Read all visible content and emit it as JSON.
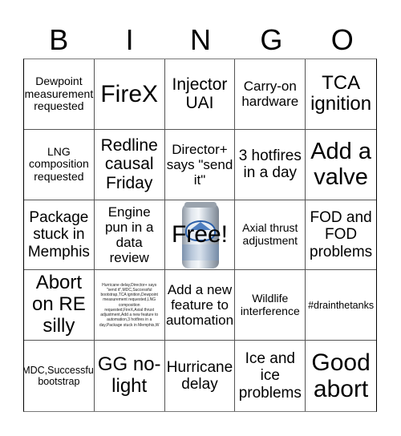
{
  "header": {
    "letters": [
      "B",
      "I",
      "N",
      "G",
      "O"
    ]
  },
  "cells": [
    "Dewpoint measurement requested",
    "FireX",
    "Injector UAI",
    "Carry-on hardware",
    "TCA ignition",
    "LNG composition requested",
    "Redline causal Friday",
    "Director+ says \"send it\"",
    "3 hotfires in a day",
    "Add a valve",
    "Package stuck in Memphis",
    "Engine pun in a data review",
    "Free!",
    "Axial thrust adjustment",
    "FOD and FOD problems",
    "Abort on RE silly",
    "Hurricane delay,Director+ says \"send it\",MDC,Successful bootstrap,TCA ignition,Dewpoint measurement requested,LNG composition requested,FireX,Axial thrust adjustment,Add a new feature to automation,3 hotfires in a day,Package stuck in Memphis,W",
    "Add a new feature to automation",
    "Wildlife interference",
    "#drainthetanks",
    "MDC,Successful bootstrap",
    "GG no-light",
    "Hurricane delay",
    "Ice and ice problems",
    "Good abort"
  ],
  "free_space": {
    "image": "beer-can-image",
    "label": "Free!"
  }
}
